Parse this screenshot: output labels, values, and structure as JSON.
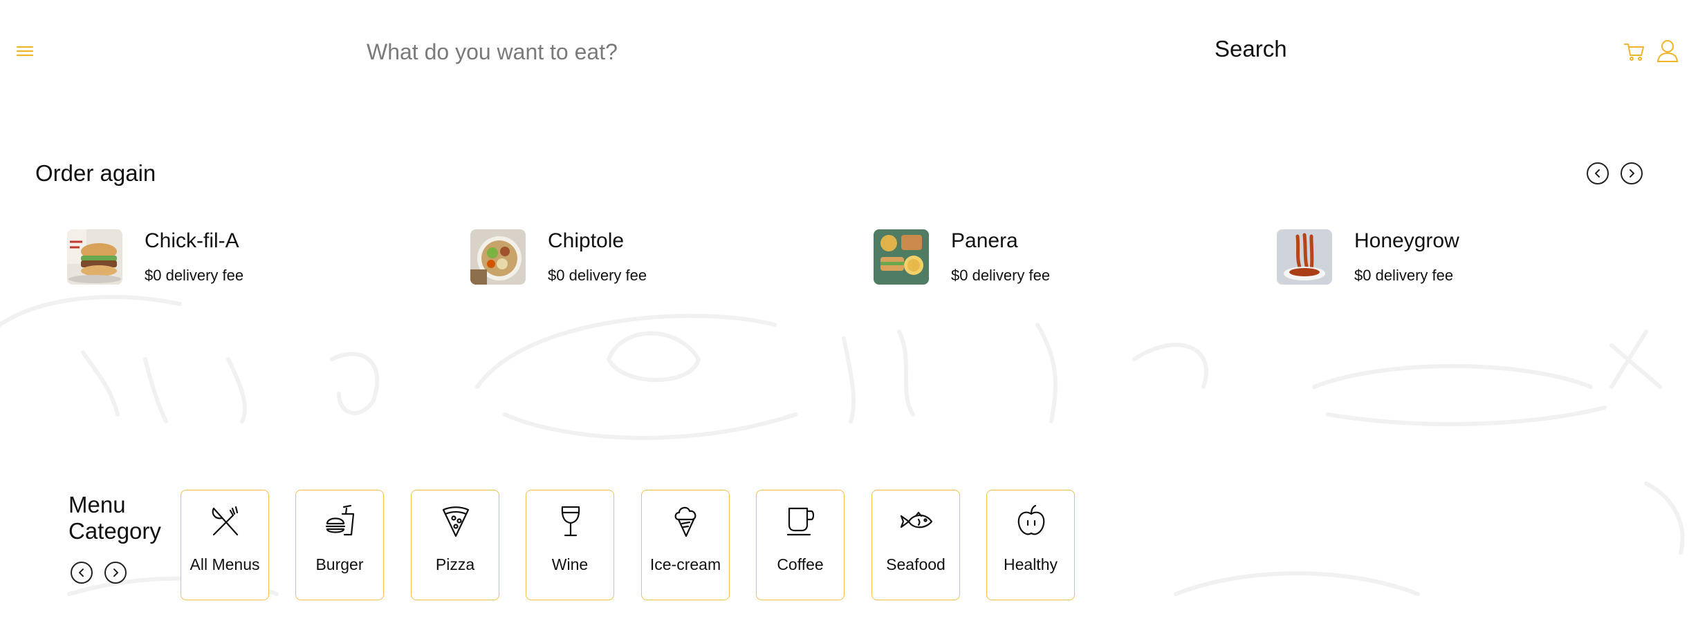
{
  "colors": {
    "accent": "#f0b429",
    "card_border": "#f0c14b",
    "text": "#111111",
    "placeholder": "#7a7a7a"
  },
  "header": {
    "menu_icon": "hamburger-icon",
    "search_placeholder": "What do you want to eat?",
    "search_label": "Search",
    "cart_icon": "cart-icon",
    "user_icon": "user-icon"
  },
  "order_again": {
    "title": "Order again",
    "prev_icon": "chevron-left-icon",
    "next_icon": "chevron-right-icon",
    "items": [
      {
        "name": "Chick-fil-A",
        "fee": "$0 delivery fee",
        "image": "chicken-sandwich-photo"
      },
      {
        "name": "Chiptole",
        "fee": "$0 delivery fee",
        "image": "burrito-bowl-photo"
      },
      {
        "name": "Panera",
        "fee": "$0 delivery fee",
        "image": "sandwich-soup-photo"
      },
      {
        "name": "Honeygrow",
        "fee": "$0 delivery fee",
        "image": "noodles-photo"
      }
    ]
  },
  "menu_category": {
    "title": "Menu Category",
    "prev_icon": "chevron-left-icon",
    "next_icon": "chevron-right-icon",
    "items": [
      {
        "label": "All Menus",
        "icon": "fork-knife-icon"
      },
      {
        "label": "Burger",
        "icon": "burger-icon"
      },
      {
        "label": "Pizza",
        "icon": "pizza-icon"
      },
      {
        "label": "Wine",
        "icon": "wine-icon"
      },
      {
        "label": "Ice-cream",
        "icon": "ice-cream-icon"
      },
      {
        "label": "Coffee",
        "icon": "coffee-icon"
      },
      {
        "label": "Seafood",
        "icon": "fish-icon"
      },
      {
        "label": "Healthy",
        "icon": "apple-icon"
      }
    ]
  }
}
